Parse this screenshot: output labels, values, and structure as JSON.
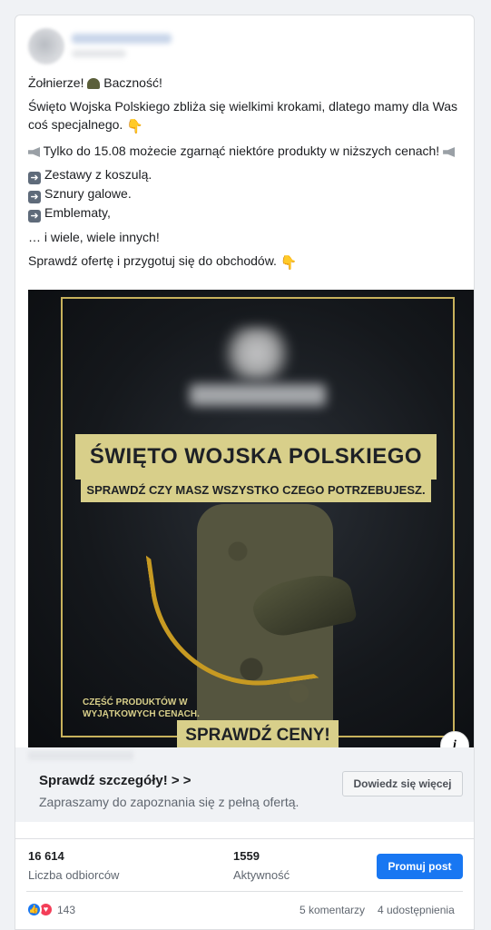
{
  "post": {
    "lines": {
      "l1": "Żołnierze!",
      "l1b": "Baczność!",
      "l2": "Święto Wojska Polskiego zbliża się wielkimi krokami, dlatego mamy dla Was coś specjalnego.",
      "l3": "Tylko do 15.08 możecie zgarnąć niektóre produkty w niższych cenach!",
      "l4": "Zestawy z koszulą.",
      "l5": "Sznury galowe.",
      "l6": "Emblematy,",
      "l7": "… i wiele, wiele innych!",
      "l8": "Sprawdź ofertę i przygotuj się do obchodów."
    },
    "icons": {
      "helmet": "helmet-emoji",
      "hand": "pointing-hand-emoji",
      "megaphone": "megaphone-emoji",
      "arrow": "right-arrow-emoji"
    }
  },
  "ad": {
    "headline": "ŚWIĘTO WOJSKA POLSKIEGO",
    "subheadline": "SPRAWDŹ CZY MASZ WSZYSTKO CZEGO POTRZEBUJESZ.",
    "small_text": "CZĘŚĆ PRODUKTÓW W WYJĄTKOWYCH CENACH.",
    "cta": "SPRAWDŹ CENY!",
    "accent_color": "#d8cf8a"
  },
  "link": {
    "title": "Sprawdź szczegóły! > >",
    "description": "Zapraszamy do zapoznania się z pełną ofertą.",
    "button": "Dowiedz się więcej"
  },
  "stats": {
    "reach_value": "16 614",
    "reach_label": "Liczba odbiorców",
    "engagement_value": "1559",
    "engagement_label": "Aktywność",
    "promote_button": "Promuj post"
  },
  "footer": {
    "reactions_count": "143",
    "comments": "5 komentarzy",
    "shares": "4 udostępnienia"
  }
}
